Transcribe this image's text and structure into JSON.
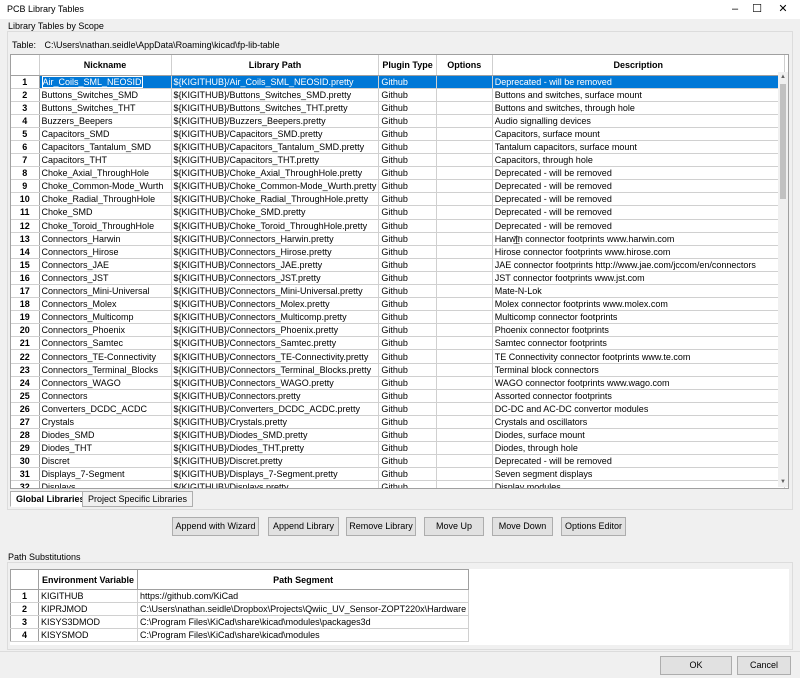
{
  "window": {
    "title": "PCB Library Tables",
    "minimize": "–",
    "maximize": "☐",
    "close": "✕"
  },
  "scope_label": "Library Tables by Scope",
  "table_path": {
    "label": "Table:",
    "value": "C:\\Users\\nathan.seidle\\AppData\\Roaming\\kicad\\fp-lib-table"
  },
  "grid": {
    "columns": [
      "Nickname",
      "Library Path",
      "Plugin Type",
      "Options",
      "Description"
    ],
    "selected_row": 1,
    "rows": [
      [
        "1",
        "Air_Coils_SML_NEOSID",
        "${KIGITHUB}/Air_Coils_SML_NEOSID.pretty",
        "Github",
        "",
        "Deprecated - will be removed"
      ],
      [
        "2",
        "Buttons_Switches_SMD",
        "${KIGITHUB}/Buttons_Switches_SMD.pretty",
        "Github",
        "",
        "Buttons and switches, surface mount"
      ],
      [
        "3",
        "Buttons_Switches_THT",
        "${KIGITHUB}/Buttons_Switches_THT.pretty",
        "Github",
        "",
        "Buttons and switches, through hole"
      ],
      [
        "4",
        "Buzzers_Beepers",
        "${KIGITHUB}/Buzzers_Beepers.pretty",
        "Github",
        "",
        "Audio signalling devices"
      ],
      [
        "5",
        "Capacitors_SMD",
        "${KIGITHUB}/Capacitors_SMD.pretty",
        "Github",
        "",
        "Capacitors, surface mount"
      ],
      [
        "6",
        "Capacitors_Tantalum_SMD",
        "${KIGITHUB}/Capacitors_Tantalum_SMD.pretty",
        "Github",
        "",
        "Tantalum capacitors, surface mount"
      ],
      [
        "7",
        "Capacitors_THT",
        "${KIGITHUB}/Capacitors_THT.pretty",
        "Github",
        "",
        "Capacitors, through hole"
      ],
      [
        "8",
        "Choke_Axial_ThroughHole",
        "${KIGITHUB}/Choke_Axial_ThroughHole.pretty",
        "Github",
        "",
        "Deprecated - will be removed"
      ],
      [
        "9",
        "Choke_Common-Mode_Wurth",
        "${KIGITHUB}/Choke_Common-Mode_Wurth.pretty",
        "Github",
        "",
        "Deprecated - will be removed"
      ],
      [
        "10",
        "Choke_Radial_ThroughHole",
        "${KIGITHUB}/Choke_Radial_ThroughHole.pretty",
        "Github",
        "",
        "Deprecated - will be removed"
      ],
      [
        "11",
        "Choke_SMD",
        "${KIGITHUB}/Choke_SMD.pretty",
        "Github",
        "",
        "Deprecated - will be removed"
      ],
      [
        "12",
        "Choke_Toroid_ThroughHole",
        "${KIGITHUB}/Choke_Toroid_ThroughHole.pretty",
        "Github",
        "",
        "Deprecated - will be removed"
      ],
      [
        "13",
        "Connectors_Harwin",
        "${KIGITHUB}/Connectors_Harwin.pretty",
        "Github",
        "",
        "Harwin connector footprints www.harwin.com"
      ],
      [
        "14",
        "Connectors_Hirose",
        "${KIGITHUB}/Connectors_Hirose.pretty",
        "Github",
        "",
        "Hirose connector footprints www.hirose.com"
      ],
      [
        "15",
        "Connectors_JAE",
        "${KIGITHUB}/Connectors_JAE.pretty",
        "Github",
        "",
        "JAE connector footprints http://www.jae.com/jccom/en/connectors"
      ],
      [
        "16",
        "Connectors_JST",
        "${KIGITHUB}/Connectors_JST.pretty",
        "Github",
        "",
        "JST connector footprints www.jst.com"
      ],
      [
        "17",
        "Connectors_Mini-Universal",
        "${KIGITHUB}/Connectors_Mini-Universal.pretty",
        "Github",
        "",
        "Mate-N-Lok"
      ],
      [
        "18",
        "Connectors_Molex",
        "${KIGITHUB}/Connectors_Molex.pretty",
        "Github",
        "",
        "Molex connector footprints www.molex.com"
      ],
      [
        "19",
        "Connectors_Multicomp",
        "${KIGITHUB}/Connectors_Multicomp.pretty",
        "Github",
        "",
        "Multicomp connector footprints"
      ],
      [
        "20",
        "Connectors_Phoenix",
        "${KIGITHUB}/Connectors_Phoenix.pretty",
        "Github",
        "",
        "Phoenix connector footprints"
      ],
      [
        "21",
        "Connectors_Samtec",
        "${KIGITHUB}/Connectors_Samtec.pretty",
        "Github",
        "",
        "Samtec connector footprints"
      ],
      [
        "22",
        "Connectors_TE-Connectivity",
        "${KIGITHUB}/Connectors_TE-Connectivity.pretty",
        "Github",
        "",
        "TE Connectivity connector footprints www.te.com"
      ],
      [
        "23",
        "Connectors_Terminal_Blocks",
        "${KIGITHUB}/Connectors_Terminal_Blocks.pretty",
        "Github",
        "",
        "Terminal block connectors"
      ],
      [
        "24",
        "Connectors_WAGO",
        "${KIGITHUB}/Connectors_WAGO.pretty",
        "Github",
        "",
        "WAGO connector footprints www.wago.com"
      ],
      [
        "25",
        "Connectors",
        "${KIGITHUB}/Connectors.pretty",
        "Github",
        "",
        "Assorted connector footprints"
      ],
      [
        "26",
        "Converters_DCDC_ACDC",
        "${KIGITHUB}/Converters_DCDC_ACDC.pretty",
        "Github",
        "",
        "DC-DC and AC-DC convertor modules"
      ],
      [
        "27",
        "Crystals",
        "${KIGITHUB}/Crystals.pretty",
        "Github",
        "",
        "Crystals and oscillators"
      ],
      [
        "28",
        "Diodes_SMD",
        "${KIGITHUB}/Diodes_SMD.pretty",
        "Github",
        "",
        "Diodes, surface mount"
      ],
      [
        "29",
        "Diodes_THT",
        "${KIGITHUB}/Diodes_THT.pretty",
        "Github",
        "",
        "Diodes, through hole"
      ],
      [
        "30",
        "Discret",
        "${KIGITHUB}/Discret.pretty",
        "Github",
        "",
        "Deprecated - will be removed"
      ],
      [
        "31",
        "Displays_7-Segment",
        "${KIGITHUB}/Displays_7-Segment.pretty",
        "Github",
        "",
        "Seven segment displays"
      ],
      [
        "32",
        "Displays",
        "${KIGITHUB}/Displays.pretty",
        "Github",
        "",
        "Display modules"
      ]
    ]
  },
  "scrollbar": {
    "up": "▲",
    "down": "▼"
  },
  "tabs": [
    "Global Libraries",
    "Project Specific Libraries"
  ],
  "buttons": {
    "append_wizard": "Append with Wizard",
    "append_library": "Append Library",
    "remove_library": "Remove Library",
    "move_up": "Move Up",
    "move_down": "Move Down",
    "options_editor": "Options Editor",
    "ok": "OK",
    "cancel": "Cancel"
  },
  "path_substitutions": {
    "label": "Path Substitutions",
    "columns": [
      "Environment Variable",
      "Path Segment"
    ],
    "rows": [
      [
        "1",
        "KIGITHUB",
        "https://github.com/KiCad"
      ],
      [
        "2",
        "KIPRJMOD",
        "C:\\Users\\nathan.seidle\\Dropbox\\Projects\\Qwiic_UV_Sensor-ZOPT220x\\Hardware"
      ],
      [
        "3",
        "KISYS3DMOD",
        "C:\\Program Files\\KiCad\\share\\kicad\\modules\\packages3d"
      ],
      [
        "4",
        "KISYSMOD",
        "C:\\Program Files\\KiCad\\share\\kicad\\modules"
      ]
    ]
  }
}
